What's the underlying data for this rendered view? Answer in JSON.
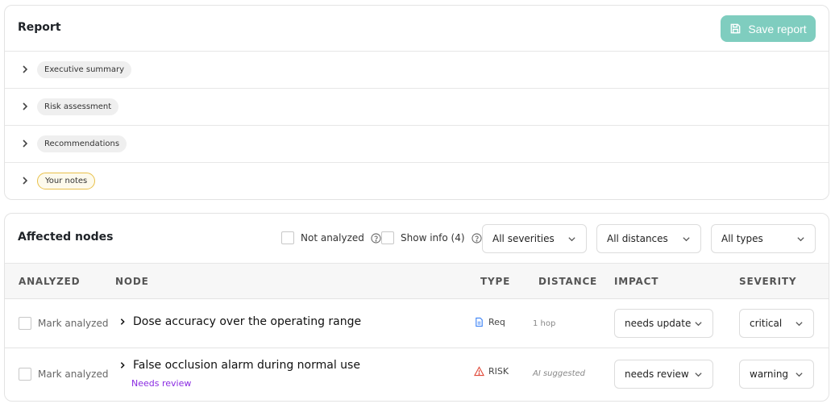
{
  "report": {
    "title": "Report",
    "save_label": "Save report",
    "sections": [
      {
        "label": "Executive summary"
      },
      {
        "label": "Risk assessment"
      },
      {
        "label": "Recommendations"
      },
      {
        "label": "Your notes"
      }
    ]
  },
  "affected": {
    "title": "Affected nodes",
    "not_analyzed_label": "Not analyzed",
    "show_info_label": "Show info (4)",
    "filters": {
      "severity": "All severities",
      "distance": "All distances",
      "type": "All types"
    },
    "columns": [
      "ANALYZED",
      "NODE",
      "TYPE",
      "DISTANCE",
      "IMPACT",
      "SEVERITY"
    ],
    "rows": [
      {
        "analyzed_label": "Mark analyzed",
        "node": "Dose accuracy over the operating range",
        "type": "Req",
        "distance": "1 hop",
        "impact": "needs update",
        "severity": "critical"
      },
      {
        "analyzed_label": "Mark analyzed",
        "node": "False occlusion alarm during normal use",
        "note": "Needs review",
        "type": "RISK",
        "distance": "AI suggested",
        "impact": "needs review",
        "severity": "warning"
      }
    ]
  },
  "colors": {
    "accent": "#7fcdbf",
    "req_icon": "#3b82f6",
    "risk_icon": "#e04a3a",
    "needs_review": "#8a2be2",
    "notes_border": "#e9c04a"
  }
}
